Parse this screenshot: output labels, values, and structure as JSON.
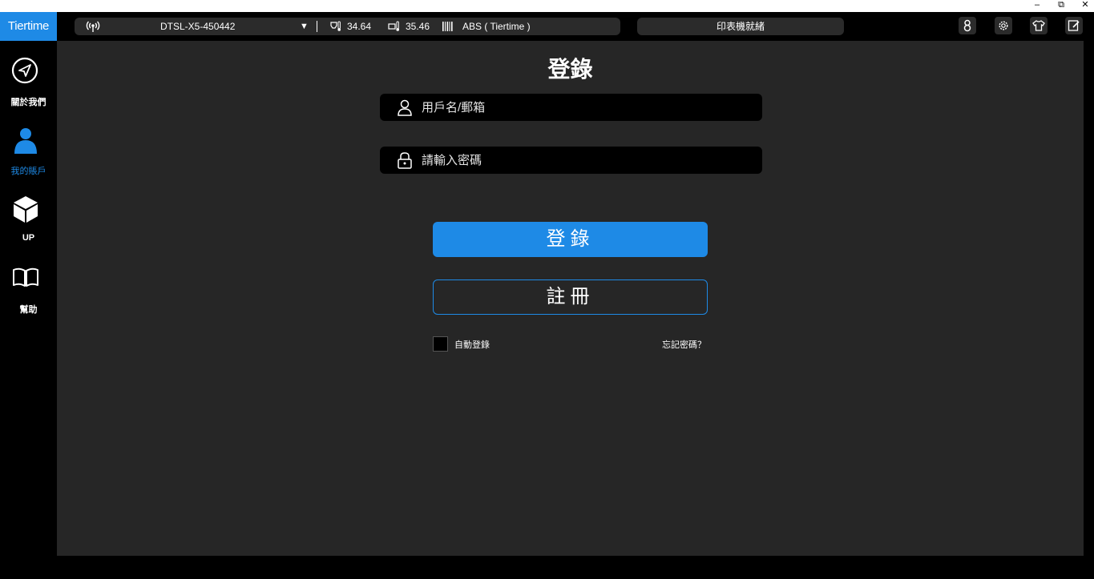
{
  "app": {
    "logo_text": "Tiertime"
  },
  "window_controls": {
    "minimize": "–",
    "restore": "⧉",
    "close": "✕"
  },
  "status_bar": {
    "printer_name": "DTSL-X5-450442",
    "dropdown_arrow": "▼",
    "nozzle_temp": "34.64",
    "bed_temp": "35.46",
    "material": "ABS ( Tiertime )",
    "printer_status": "印表機就緒"
  },
  "toolbar_icons": [
    "calibration-icon",
    "gear-icon",
    "tshirt-icon",
    "edit-icon"
  ],
  "sidebar": {
    "items": [
      {
        "label": "關於我們",
        "icon": "send-icon",
        "active": false
      },
      {
        "label": "我的賬戶",
        "icon": "user-icon",
        "active": true
      },
      {
        "label": "UP",
        "icon": "cube-icon",
        "active": false
      },
      {
        "label": "幫助",
        "icon": "book-icon",
        "active": false
      }
    ]
  },
  "login": {
    "title": "登錄",
    "username_placeholder": "用戶名/郵箱",
    "username_value": "",
    "password_placeholder": "請輸入密碼",
    "password_value": "",
    "login_button": "登錄",
    "register_button": "註冊",
    "auto_login_label": "自動登錄",
    "auto_login_checked": false,
    "forgot_password": "忘記密碼？"
  },
  "colors": {
    "accent": "#1e8ae6",
    "background": "#262626",
    "sidebar": "#000000",
    "pill": "#2b2b2b"
  }
}
